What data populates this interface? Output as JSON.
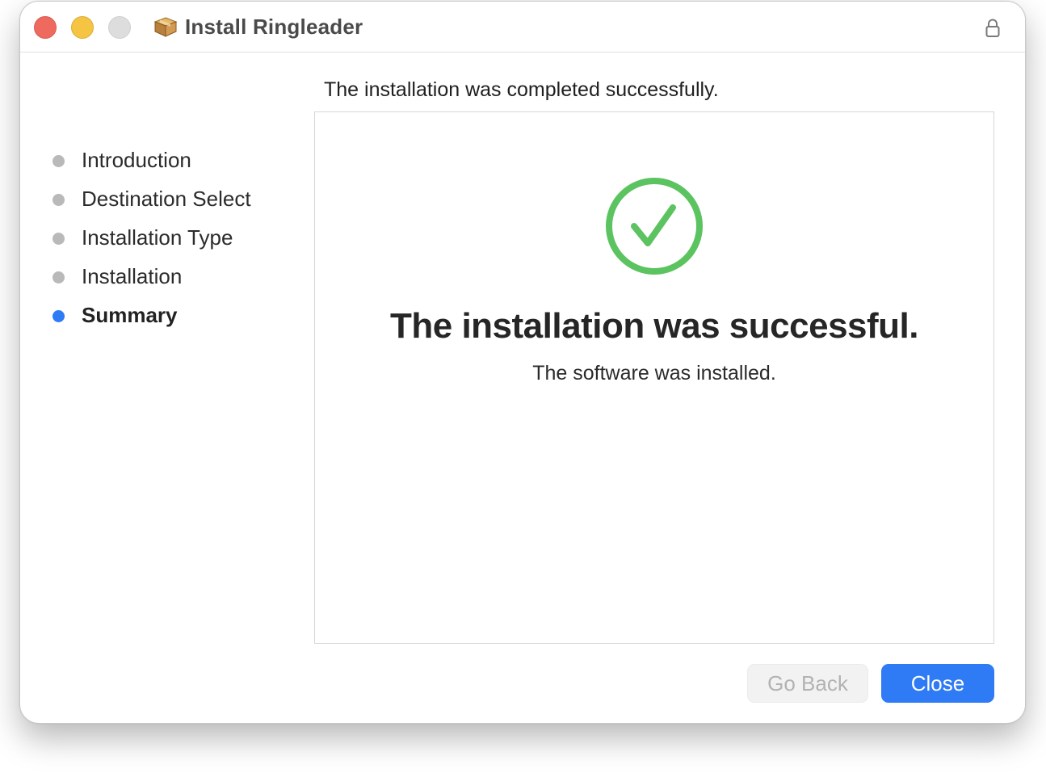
{
  "window": {
    "title": "Install Ringleader"
  },
  "sidebar": {
    "steps": [
      {
        "label": "Introduction",
        "active": false
      },
      {
        "label": "Destination Select",
        "active": false
      },
      {
        "label": "Installation Type",
        "active": false
      },
      {
        "label": "Installation",
        "active": false
      },
      {
        "label": "Summary",
        "active": true
      }
    ]
  },
  "main": {
    "header": "The installation was completed successfully.",
    "success_title": "The installation was successful.",
    "success_subtitle": "The software was installed.",
    "status_icon": "checkmark-circle-icon"
  },
  "buttons": {
    "go_back_label": "Go Back",
    "close_label": "Close"
  },
  "colors": {
    "accent": "#2f7bf5",
    "success": "#5bc35f",
    "traffic_close": "#ee6a5f",
    "traffic_minimize": "#f5c443",
    "traffic_zoom_disabled": "#dddddd",
    "step_inactive": "#b9b9b9"
  },
  "icons": {
    "title": "package-icon",
    "lock": "lock-icon"
  }
}
